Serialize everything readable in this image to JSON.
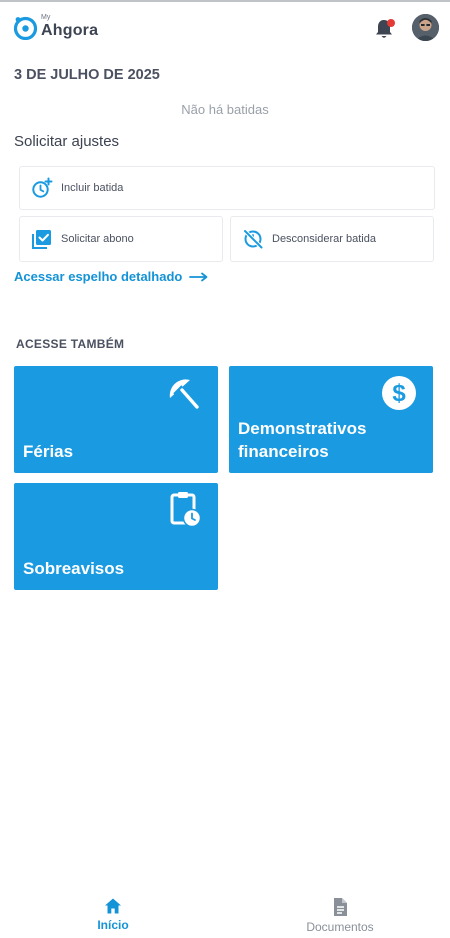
{
  "header": {
    "brand_prefix": "My",
    "brand_name": "Ahgora",
    "icons": [
      "notification-bell-icon",
      "user-avatar"
    ],
    "notification_dot_color": "#e53935"
  },
  "main": {
    "date": "3 DE JULHO DE 2025",
    "empty_message": "Não há batidas",
    "adjust_section_title": "Solicitar ajustes",
    "actions": [
      {
        "label": "Incluir batida",
        "icon": "clock-plus-icon"
      },
      {
        "label": "Solicitar abono",
        "icon": "checkbox-stack-icon"
      },
      {
        "label": "Desconsiderar batida",
        "icon": "clock-off-icon"
      }
    ],
    "detail_link": "Acessar espelho detalhado",
    "also_title": "ACESSE TAMBÉM",
    "tiles": [
      {
        "label": "Férias",
        "icon": "beach-umbrella-icon"
      },
      {
        "label": "Demonstrativos financeiros",
        "icon": "dollar-circle-icon"
      },
      {
        "label": "Sobreavisos",
        "icon": "clipboard-clock-icon"
      }
    ]
  },
  "bottom_nav": {
    "items": [
      {
        "label": "Início",
        "icon": "home-icon",
        "active": true
      },
      {
        "label": "Documentos",
        "icon": "document-icon",
        "active": false
      }
    ]
  },
  "colors": {
    "accent": "#1493d6",
    "tile_background": "#1a9ae0",
    "text": "#4b5160"
  }
}
